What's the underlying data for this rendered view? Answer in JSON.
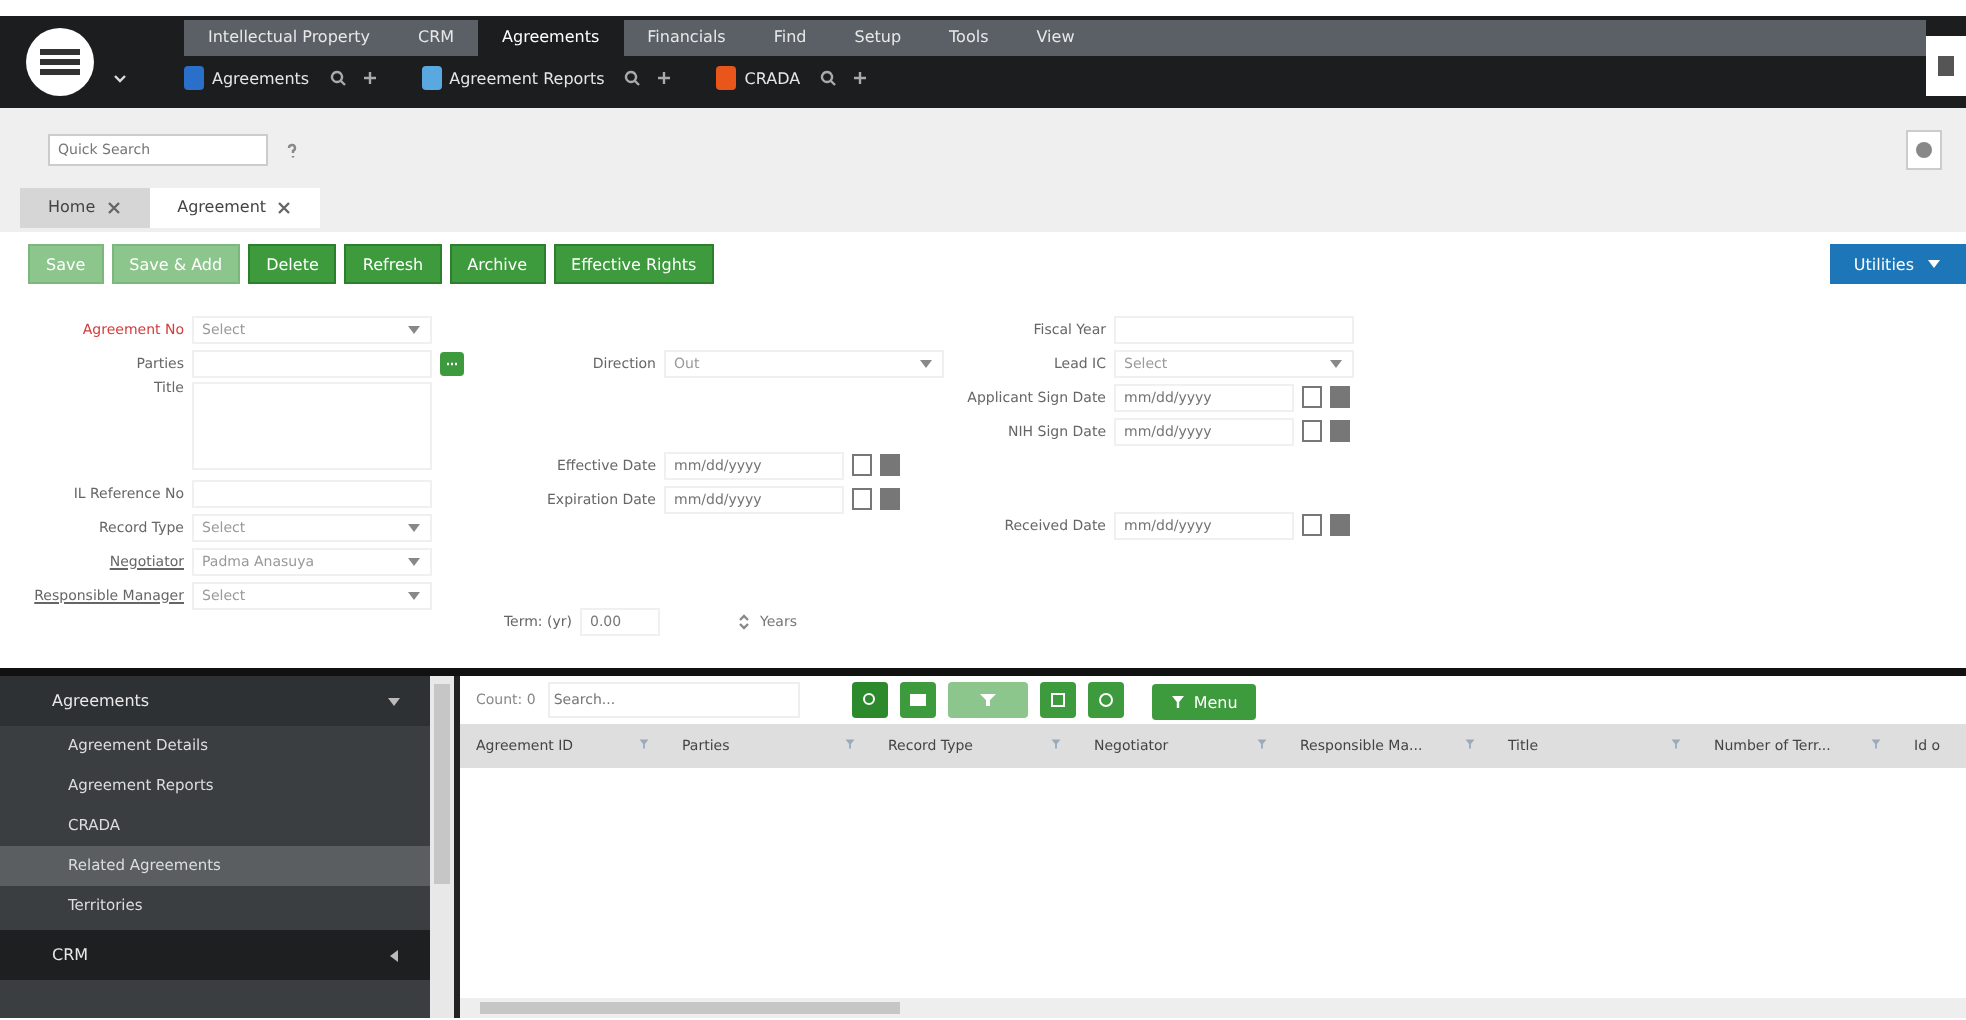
{
  "menu": [
    {
      "label": "Intellectual Property",
      "selected": false
    },
    {
      "label": "CRM",
      "selected": false
    },
    {
      "label": "Agreements",
      "selected": true
    },
    {
      "label": "Financials",
      "selected": false
    },
    {
      "label": "Find",
      "selected": false
    },
    {
      "label": "Setup",
      "selected": false
    },
    {
      "label": "Tools",
      "selected": false
    },
    {
      "label": "View",
      "selected": false
    }
  ],
  "toolbar": [
    {
      "label": "Agreements",
      "color": "#2a6fc9"
    },
    {
      "label": "Agreement Reports",
      "color": "#5aa8e0"
    },
    {
      "label": "CRADA",
      "color": "#e8561c"
    }
  ],
  "quick_search": {
    "placeholder": "Quick Search"
  },
  "tabs": [
    {
      "label": "Home",
      "selected": false
    },
    {
      "label": "Agreement",
      "selected": true
    }
  ],
  "actions": [
    {
      "label": "Save",
      "disabled": true
    },
    {
      "label": "Save & Add",
      "disabled": true
    },
    {
      "label": "Delete",
      "disabled": false
    },
    {
      "label": "Refresh",
      "disabled": false
    },
    {
      "label": "Archive",
      "disabled": false
    },
    {
      "label": "Effective Rights",
      "disabled": false
    }
  ],
  "utilities": "Utilities",
  "form": {
    "columns": [
      [
        {
          "label": "Agreement No",
          "kind": "select",
          "value": "Select",
          "required": true
        },
        {
          "label": "Parties",
          "kind": "lookup"
        },
        {
          "label": "Title",
          "kind": "textarea"
        },
        {
          "label": "IL Reference No",
          "kind": "text"
        },
        {
          "label": "Record Type",
          "kind": "select",
          "value": "Select"
        },
        {
          "label": "Negotiator",
          "kind": "select",
          "value": "Padma Anasuya",
          "link": true
        },
        {
          "label": "Responsible Manager",
          "kind": "select",
          "value": "Select",
          "link": true
        }
      ],
      [
        {
          "label": "Direction",
          "kind": "select",
          "value": "Out"
        },
        {
          "label": "Effective Date",
          "kind": "date",
          "placeholder": "mm/dd/yyyy"
        },
        {
          "label": "Expiration Date",
          "kind": "date",
          "placeholder": "mm/dd/yyyy"
        },
        {
          "label": "Term: (yr)",
          "kind": "number",
          "value": "0.00",
          "unit": "Years"
        }
      ],
      [
        {
          "label": "Fiscal Year",
          "kind": "text"
        },
        {
          "label": "Lead IC",
          "kind": "select",
          "value": "Select"
        },
        {
          "label": "Applicant Sign Date",
          "kind": "date",
          "placeholder": "mm/dd/yyyy"
        },
        {
          "label": "NIH Sign Date",
          "kind": "date",
          "placeholder": "mm/dd/yyyy"
        },
        {
          "label": "Received Date",
          "kind": "date",
          "placeholder": "mm/dd/yyyy"
        }
      ]
    ]
  },
  "sidebar": [
    {
      "label": "Agreements",
      "expanded": true,
      "children": [
        {
          "label": "Agreement Details",
          "selected": false
        },
        {
          "label": "Agreement Reports",
          "selected": false
        },
        {
          "label": "CRADA",
          "selected": false
        },
        {
          "label": "Related Agreements",
          "selected": true
        },
        {
          "label": "Territories",
          "selected": false
        }
      ]
    },
    {
      "label": "CRM",
      "expanded": false
    }
  ],
  "grid": {
    "count": "Count: 0",
    "search_placeholder": "Search...",
    "menu": "Menu",
    "columns": [
      "Agreement ID",
      "Parties",
      "Record Type",
      "Negotiator",
      "Responsible Ma...",
      "Title",
      "Number of Terr...",
      "Id o"
    ]
  }
}
